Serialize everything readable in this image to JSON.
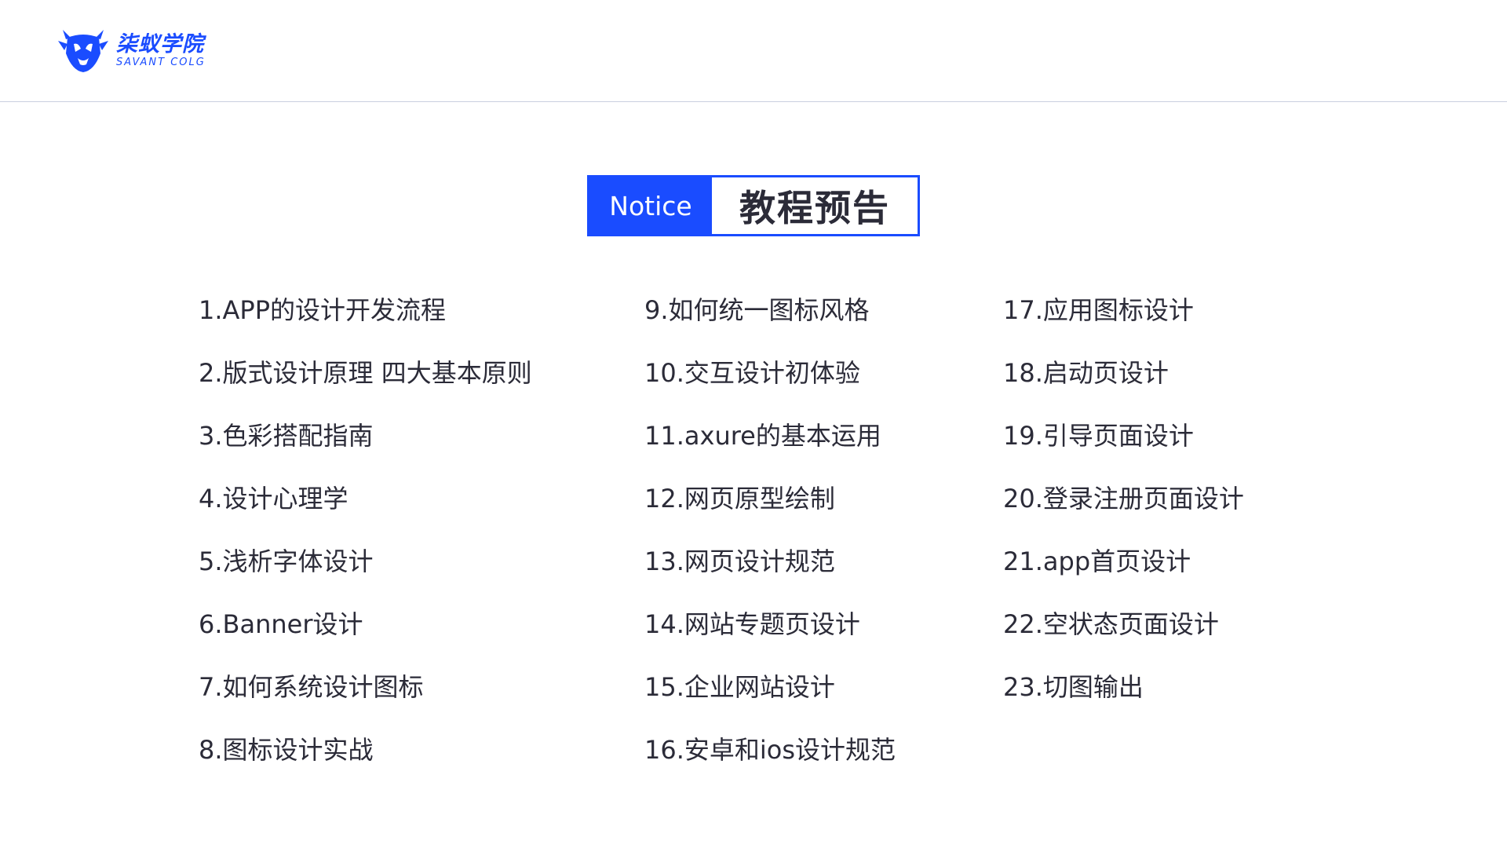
{
  "brand": {
    "name_cn": "柒蚁学院",
    "name_en": "SAVANT COLG",
    "color": "#1a4cff"
  },
  "notice": {
    "tag": "Notice",
    "title": "教程预告"
  },
  "courses": {
    "column1": [
      "1.APP的设计开发流程",
      "2.版式设计原理 四大基本原则",
      "3.色彩搭配指南",
      "4.设计心理学",
      "5.浅析字体设计",
      "6.Banner设计",
      "7.如何系统设计图标",
      "8.图标设计实战"
    ],
    "column2": [
      "9.如何统一图标风格",
      "10.交互设计初体验",
      "11.axure的基本运用",
      "12.网页原型绘制",
      "13.网页设计规范",
      "14.网站专题页设计",
      "15.企业网站设计",
      "16.安卓和ios设计规范"
    ],
    "column3": [
      "17.应用图标设计",
      "18.启动页设计",
      "19.引导页面设计",
      "20.登录注册页面设计",
      "21.app首页设计",
      "22.空状态页面设计",
      "23.切图输出"
    ]
  }
}
